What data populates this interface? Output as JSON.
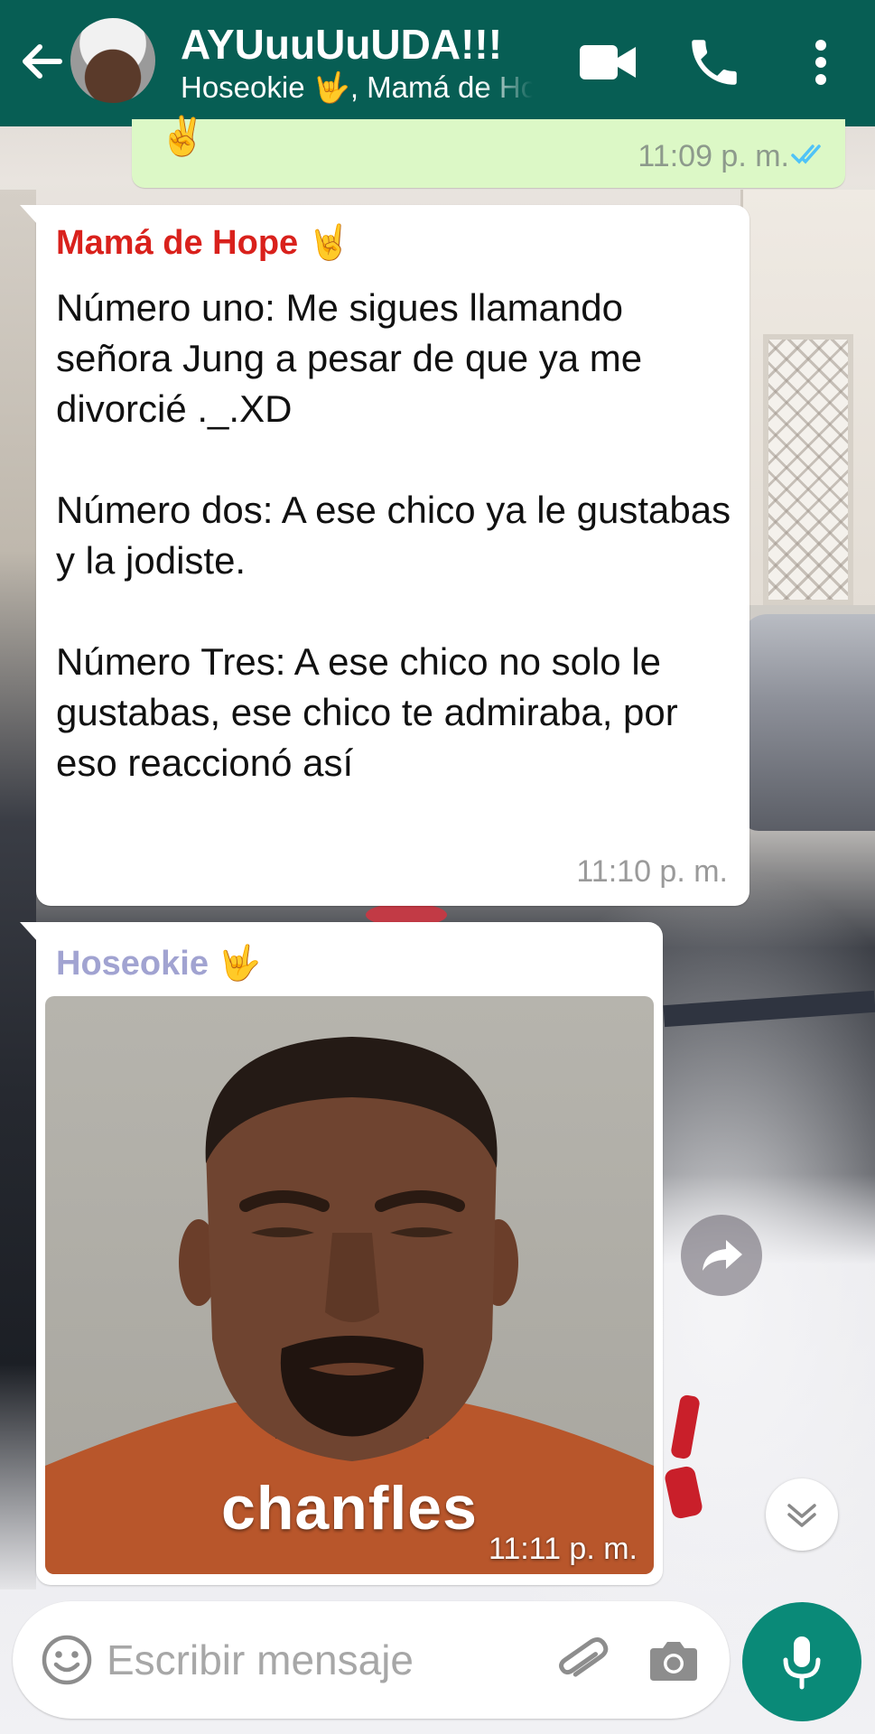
{
  "header": {
    "title": "AYUuuUuUDA!!!",
    "subtitle": "Hoseokie 🤟, Mamá de Hope 🤘",
    "icons": {
      "back": "arrow-left-icon",
      "video": "video-camera-icon",
      "call": "phone-icon",
      "menu": "more-vertical-icon"
    }
  },
  "messages": {
    "outgoing_partial": {
      "emoji": "✌️",
      "time": "11:09 p. m.",
      "status": "read"
    },
    "msg1": {
      "sender": "Mamá de Hope 🤘",
      "text": "Número uno: Me sigues llamando señora Jung a pesar de que ya me divorcié ._.XD\n\nNúmero dos: A ese chico ya le gustabas y la jodiste.\n\nNúmero Tres: A ese chico no solo le gustabas, ese chico te admiraba, por eso reaccionó así",
      "time": "11:10 p. m."
    },
    "msg2": {
      "sender": "Hoseokie 🤟",
      "image_caption": "chanfles",
      "time": "11:11 p. m."
    }
  },
  "floating": {
    "forward": "forward-arrow-icon",
    "scroll_down": "double-chevron-down-icon"
  },
  "composer": {
    "placeholder": "Escribir mensaje",
    "value": "",
    "icons": {
      "emoji": "smiley-icon",
      "attach": "paperclip-icon",
      "camera": "camera-icon",
      "mic": "microphone-icon"
    }
  },
  "colors": {
    "header": "#075e54",
    "outgoing_bubble": "#dcf8c6",
    "incoming_bubble": "#ffffff",
    "sender_red": "#d9211c",
    "sender_lilac": "#a1a3d1",
    "read_ticks": "#4fc3f7",
    "mic_button": "#0a8a78"
  }
}
